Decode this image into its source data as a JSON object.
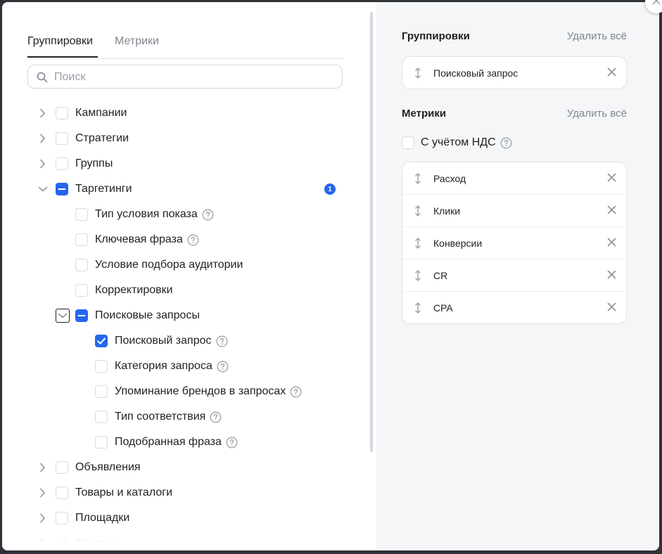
{
  "left": {
    "tabs": [
      {
        "label": "Группировки",
        "active": true
      },
      {
        "label": "Метрики",
        "active": false
      }
    ],
    "search": {
      "placeholder": "Поиск"
    },
    "tree": [
      {
        "label": "Кампании",
        "state": "unchecked"
      },
      {
        "label": "Стратегии",
        "state": "unchecked"
      },
      {
        "label": "Группы",
        "state": "unchecked"
      },
      {
        "label": "Таргетинги",
        "state": "partial",
        "expanded": true,
        "badge": "1"
      },
      {
        "label": "Тип условия показа",
        "state": "unchecked",
        "help": true
      },
      {
        "label": "Ключевая фраза",
        "state": "unchecked",
        "help": true
      },
      {
        "label": "Условие подбора аудитории",
        "state": "unchecked"
      },
      {
        "label": "Корректировки",
        "state": "unchecked"
      },
      {
        "label": "Поисковые запросы",
        "state": "partial",
        "expanded": true
      },
      {
        "label": "Поисковый запрос",
        "state": "checked",
        "help": true
      },
      {
        "label": "Категория запроса",
        "state": "unchecked",
        "help": true
      },
      {
        "label": "Упоминание брендов в запросах",
        "state": "unchecked",
        "help": true
      },
      {
        "label": "Тип соответствия",
        "state": "unchecked",
        "help": true
      },
      {
        "label": "Подобранная фраза",
        "state": "unchecked",
        "help": true
      },
      {
        "label": "Объявления",
        "state": "unchecked"
      },
      {
        "label": "Товары и каталоги",
        "state": "unchecked"
      },
      {
        "label": "Площадки",
        "state": "unchecked"
      },
      {
        "label": "Регионы",
        "state": "disabled"
      }
    ]
  },
  "right": {
    "groupings": {
      "title": "Группировки",
      "delete_all": "Удалить всё",
      "items": [
        "Поисковый запрос"
      ]
    },
    "metrics": {
      "title": "Метрики",
      "delete_all": "Удалить всё",
      "vat_label": "С учётом НДС",
      "items": [
        "Расход",
        "Клики",
        "Конверсии",
        "CR",
        "CPA"
      ]
    }
  },
  "colors": {
    "accent": "#2566ef",
    "text": "#1f2022",
    "muted": "#80868f",
    "panel": "#f5f6f8"
  }
}
